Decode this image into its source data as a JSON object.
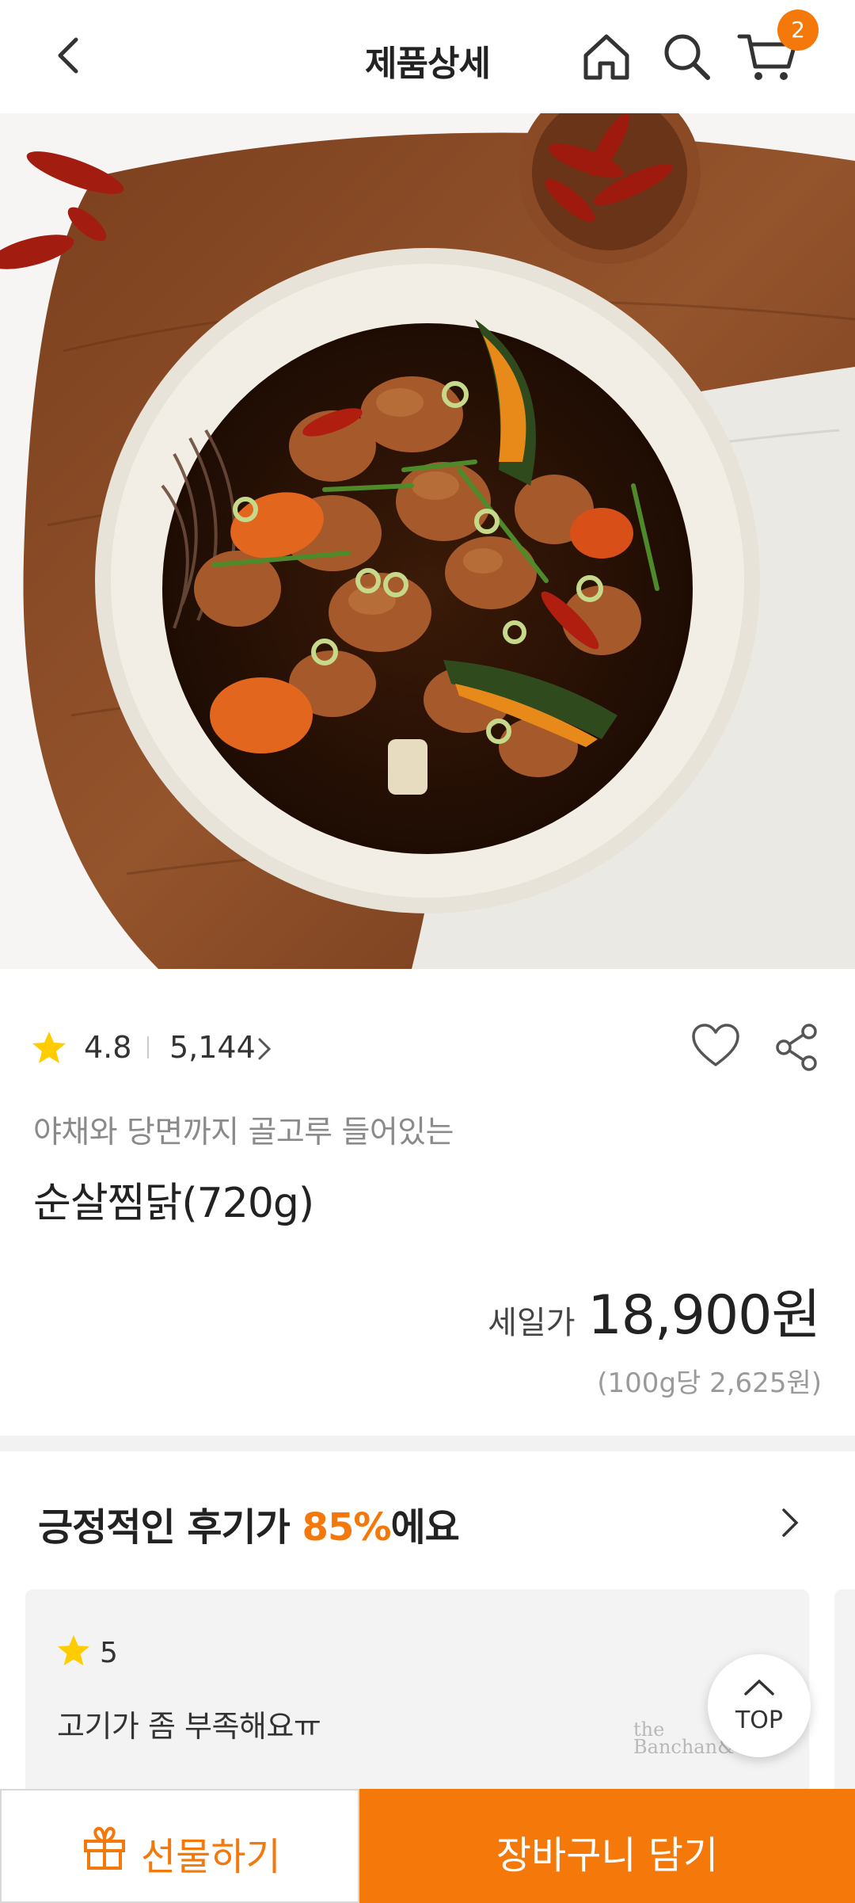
{
  "header": {
    "title": "제품상세",
    "cart_count": "2"
  },
  "product": {
    "image_alt": "순살찜닭 plated dish",
    "rating": "4.8",
    "review_count": "5,144",
    "subtitle": "야채와 당면까지 골고루 들어있는",
    "name": "순살찜닭(720g)",
    "price_label": "세일가",
    "price": "18,900원",
    "unit_price": "(100g당 2,625원)"
  },
  "reviews": {
    "heading_prefix": "긍정적인 후기가 ",
    "heading_percent": "85%",
    "heading_suffix": "에요",
    "items": [
      {
        "score": "5",
        "text": "고기가 좀 부족해요ㅠ",
        "brand_logo_line1": "the",
        "brand_logo_line2": "Banchan&"
      }
    ]
  },
  "floating": {
    "top_label": "TOP"
  },
  "bottom_bar": {
    "gift_label": "선물하기",
    "cart_label": "장바구니 담기"
  },
  "colors": {
    "accent": "#f5780a",
    "star": "#ffcc00"
  }
}
